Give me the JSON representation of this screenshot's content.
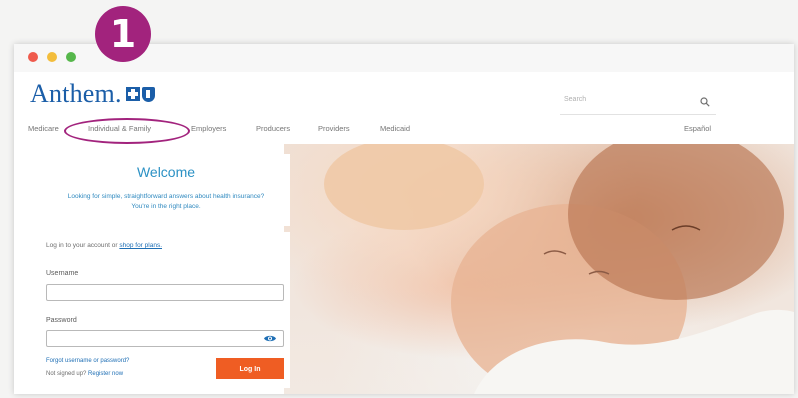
{
  "step_badge": "1",
  "window": {
    "controls": [
      "close",
      "minimize",
      "maximize"
    ]
  },
  "header": {
    "logo_text": "Anthem.",
    "logo_symbols": [
      "blue-cross-icon",
      "blue-shield-icon"
    ],
    "search_placeholder": "Search",
    "language_link": "Español"
  },
  "nav": {
    "items": [
      {
        "label": "Medicare"
      },
      {
        "label": "Individual & Family"
      },
      {
        "label": "Employers"
      },
      {
        "label": "Producers"
      },
      {
        "label": "Providers"
      },
      {
        "label": "Medicaid"
      }
    ],
    "highlighted": "Individual & Family"
  },
  "welcome": {
    "title": "Welcome",
    "subtitle": "Looking for simple, straightforward answers about health insurance? You're in the right place."
  },
  "login": {
    "intro_text": "Log in to your account or",
    "shop_link": "shop for plans.",
    "username_label": "Username",
    "username_value": "",
    "password_label": "Password",
    "password_value": "",
    "forgot_link": "Forgot username or password?",
    "register_prefix": "Not signed up?",
    "register_link": "Register now",
    "login_button": "Log In"
  },
  "colors": {
    "brand_blue": "#1b5ea8",
    "accent_magenta": "#a2237d",
    "login_orange": "#ef5d23"
  }
}
